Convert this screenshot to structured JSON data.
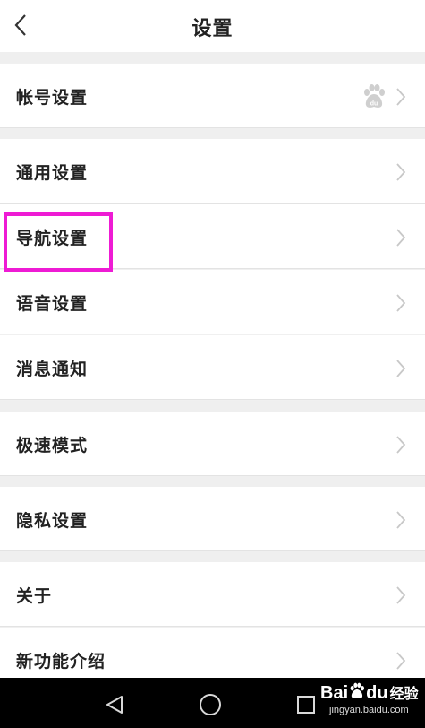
{
  "header": {
    "title": "设置"
  },
  "settings": {
    "account": "帐号设置",
    "general": "通用设置",
    "navigation": "导航设置",
    "voice": "语音设置",
    "notifications": "消息通知",
    "speed_mode": "极速模式",
    "privacy": "隐私设置",
    "about": "关于",
    "new_features": "新功能介绍"
  },
  "icons": {
    "back": "chevron-left-icon",
    "row_arrow": "chevron-right-icon",
    "account_badge": "baidu-paw-icon"
  },
  "colors": {
    "highlight": "#ee1bd4",
    "chevron": "#c8c8c8"
  },
  "watermark": {
    "brand": "Bai",
    "brand_suffix": "du",
    "cn": "经验",
    "url": "jingyan.baidu.com"
  }
}
